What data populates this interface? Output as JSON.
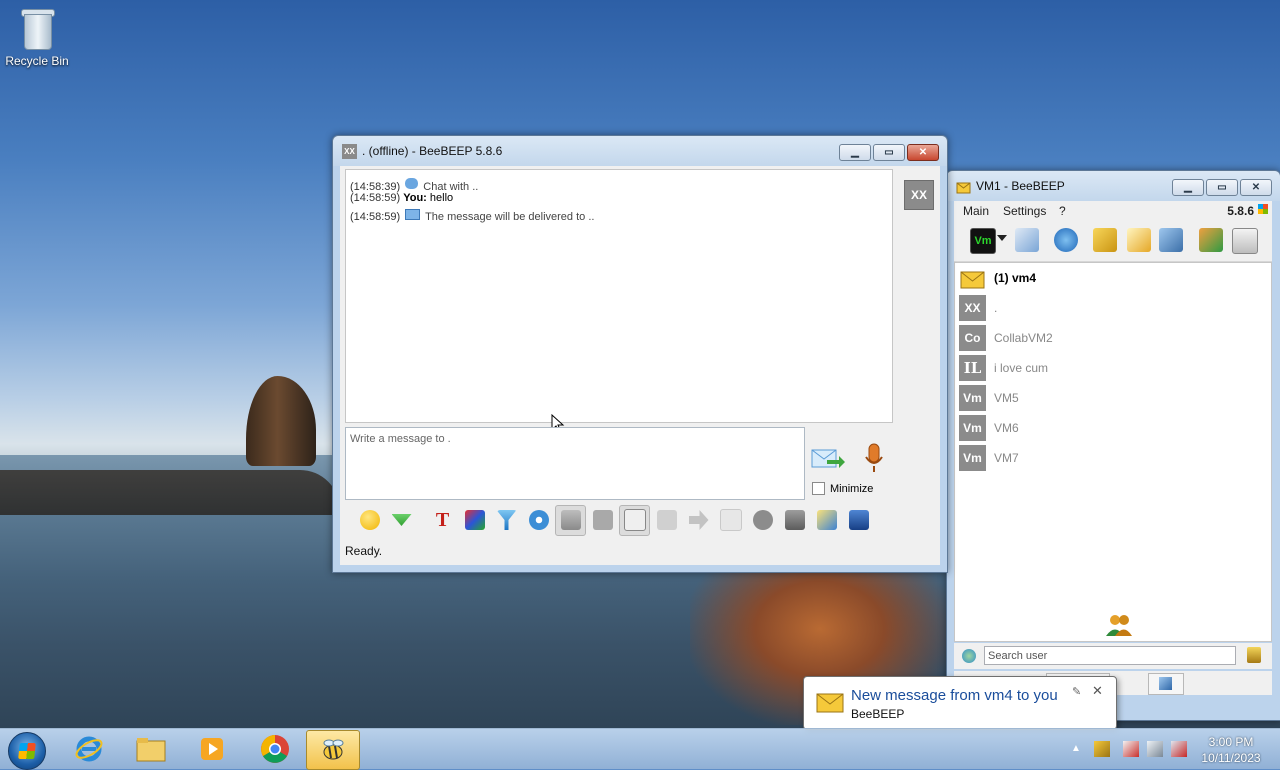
{
  "desktop": {
    "recycle_bin_label": "Recycle Bin"
  },
  "chat_window": {
    "title": ". (offline) - BeeBEEP 5.8.6",
    "title_icon_text": "XX",
    "avatar_text": "XX",
    "messages": [
      {
        "time": "(14:58:39)",
        "icon": "chat-bubble-icon",
        "sender": "",
        "text": "Chat with .."
      },
      {
        "time": "(14:58:59)",
        "icon": "",
        "sender": "You:",
        "text": "hello"
      },
      {
        "time": "(14:58:59)",
        "icon": "envelope-icon",
        "sender": "",
        "text": "The message will be delivered to .."
      }
    ],
    "compose_placeholder": "Write a message to .",
    "minimize_label": "Minimize",
    "status": "Ready."
  },
  "main_window": {
    "title": "VM1 - BeeBEEP",
    "menu": {
      "main": "Main",
      "settings": "Settings",
      "help": "?"
    },
    "version": "5.8.6",
    "status_button_text": "Vm",
    "users": [
      {
        "avatar": "",
        "name": "(1) vm4",
        "unread": true
      },
      {
        "avatar": "XX",
        "name": "."
      },
      {
        "avatar": "Co",
        "name": "CollabVM2"
      },
      {
        "avatar": "IL",
        "name": "i love cum"
      },
      {
        "avatar": "Vm",
        "name": "VM5"
      },
      {
        "avatar": "Vm",
        "name": "VM6"
      },
      {
        "avatar": "Vm",
        "name": "VM7"
      }
    ],
    "search_placeholder": "Search user",
    "tab_count": "1"
  },
  "notification": {
    "title": "New message from vm4 to you",
    "source": "BeeBEEP"
  },
  "taskbar": {
    "time": "3:00 PM",
    "date": "10/11/2023"
  },
  "colors": {
    "avatar_gray": "#8b8b8b",
    "link_blue": "#1a4d9b",
    "taskbar_active": "#f2c24b"
  }
}
